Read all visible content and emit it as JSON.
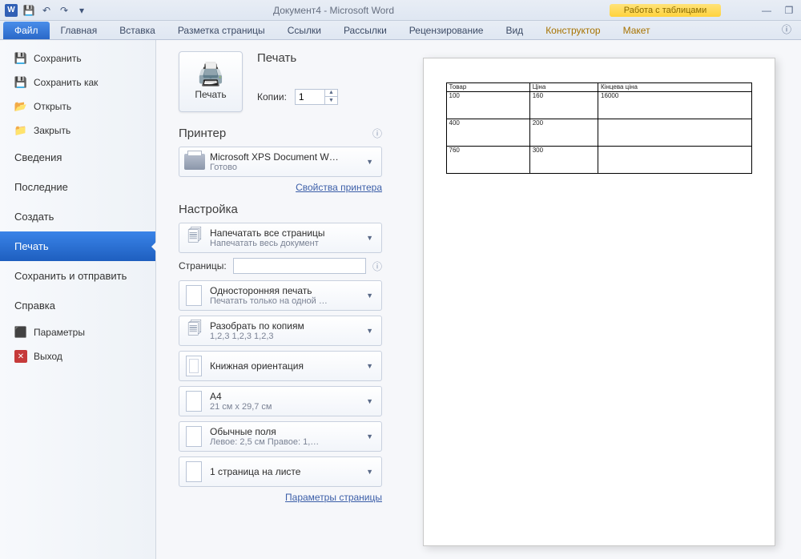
{
  "title": "Документ4  -  Microsoft Word",
  "tableTools": "Работа с таблицами",
  "tabs": {
    "file": "Файл",
    "home": "Главная",
    "insert": "Вставка",
    "layout": "Разметка страницы",
    "refs": "Ссылки",
    "mail": "Рассылки",
    "review": "Рецензирование",
    "view": "Вид",
    "design": "Конструктор",
    "tlayout": "Макет"
  },
  "sidebar": {
    "save": "Сохранить",
    "saveAs": "Сохранить как",
    "open": "Открыть",
    "close": "Закрыть",
    "info": "Сведения",
    "recent": "Последние",
    "new": "Создать",
    "print": "Печать",
    "share": "Сохранить и отправить",
    "help": "Справка",
    "options": "Параметры",
    "exit": "Выход"
  },
  "print": {
    "heading": "Печать",
    "button": "Печать",
    "copiesLabel": "Копии:",
    "copiesValue": "1"
  },
  "printer": {
    "heading": "Принтер",
    "name": "Microsoft XPS Document W…",
    "status": "Готово",
    "propsLink": "Свойства принтера"
  },
  "settings": {
    "heading": "Настройка",
    "scopeTitle": "Напечатать все страницы",
    "scopeSub": "Напечатать весь документ",
    "pagesLabel": "Страницы:",
    "pagesValue": "",
    "duplexTitle": "Односторонняя печать",
    "duplexSub": "Печатать только на одной …",
    "collateTitle": "Разобрать по копиям",
    "collateSub": "1,2,3   1,2,3   1,2,3",
    "orientTitle": "Книжная ориентация",
    "sizeTitle": "A4",
    "sizeSub": "21 см x 29,7 см",
    "marginsTitle": "Обычные поля",
    "marginsSub": "Левое: 2,5 см   Правое: 1,…",
    "perSheetTitle": "1 страница на листе",
    "pageSetupLink": "Параметры страницы"
  },
  "doc": {
    "headers": [
      "Товар",
      "Ціна",
      "Кінцева ціна"
    ],
    "rows": [
      [
        "100",
        "160",
        "16000"
      ],
      [
        "400",
        "200",
        ""
      ],
      [
        "760",
        "300",
        ""
      ]
    ]
  }
}
